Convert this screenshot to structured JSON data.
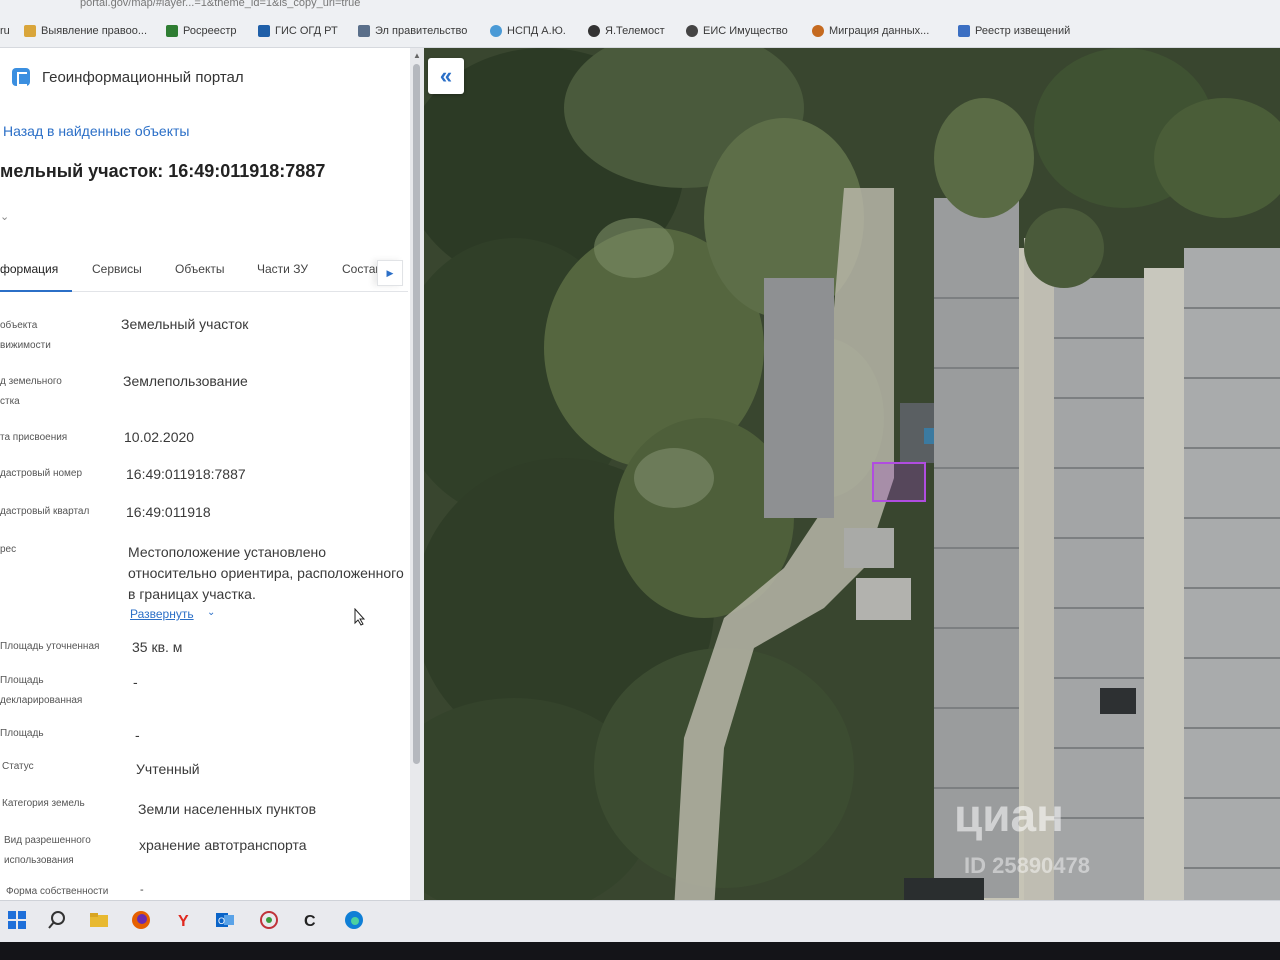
{
  "browser": {
    "url_fragment": "portal.gov/map/#layer...=1&theme_id=1&is_copy_url=true",
    "bookmarks": [
      {
        "label": "ru",
        "icon": "none"
      },
      {
        "label": "Выявление правоо...",
        "icon": "scales-icon"
      },
      {
        "label": "Росреестр",
        "icon": "rosreestr-icon"
      },
      {
        "label": "ГИС ОГД РТ",
        "icon": "building-icon"
      },
      {
        "label": "Эл правительство",
        "icon": "document-icon"
      },
      {
        "label": "НСПД А.Ю.",
        "icon": "globe-icon"
      },
      {
        "label": "Я.Телемост",
        "icon": "camera-icon"
      },
      {
        "label": "ЕИС Имущество",
        "icon": "globe-icon"
      },
      {
        "label": "Миграция данных...",
        "icon": "gear-icon"
      },
      {
        "label": "Реестр извещений",
        "icon": "shield-icon"
      }
    ]
  },
  "panel": {
    "portal_title": "Геоинформационный портал",
    "back_link": "Назад в найденные объекты",
    "object_title": "мельный участок: 16:49:011918:7887",
    "tabs": [
      {
        "label": "формация",
        "active": true
      },
      {
        "label": "Сервисы",
        "active": false
      },
      {
        "label": "Объекты",
        "active": false
      },
      {
        "label": "Части ЗУ",
        "active": false
      },
      {
        "label": "Состав",
        "active": false
      }
    ],
    "properties": [
      {
        "label_lines": [
          "объекта",
          "вижимости"
        ],
        "value": "Земельный участок"
      },
      {
        "label_lines": [
          "д земельного",
          "стка"
        ],
        "value": "Землепользование"
      },
      {
        "label_lines": [
          "та присвоения"
        ],
        "value": "10.02.2020"
      },
      {
        "label_lines": [
          "дастровый номер"
        ],
        "value": "16:49:011918:7887"
      },
      {
        "label_lines": [
          "дастровый квартал"
        ],
        "value": "16:49:011918"
      },
      {
        "label_lines": [
          "рес"
        ],
        "value": "Местоположение установлено относительно ориентира, расположенного в границах участка."
      },
      {
        "label_lines": [
          "Площадь уточненная"
        ],
        "value": "35 кв. м"
      },
      {
        "label_lines": [
          "Площадь",
          "декларированная"
        ],
        "value": "-"
      },
      {
        "label_lines": [
          "Площадь"
        ],
        "value": "-"
      },
      {
        "label_lines": [
          "Статус"
        ],
        "value": "Учтенный"
      },
      {
        "label_lines": [
          "Категория земель"
        ],
        "value": "Земли населенных пунктов"
      },
      {
        "label_lines": [
          "Вид разрешенного",
          "использования"
        ],
        "value": "хранение автотранспорта"
      },
      {
        "label_lines": [
          "Форма собственности"
        ],
        "value": "-"
      }
    ],
    "expand_link": "Развернуть"
  },
  "map": {
    "collapse_button": "«",
    "watermark": "циан",
    "watermark_id": "ID 25890478",
    "parcel_color": "#b04de0"
  },
  "taskbar": {
    "icons": [
      "windows-start-icon",
      "search-icon",
      "file-explorer-icon",
      "firefox-icon",
      "yandex-browser-icon",
      "outlook-icon",
      "app-icon",
      "c-app-icon",
      "edge-icon"
    ]
  }
}
